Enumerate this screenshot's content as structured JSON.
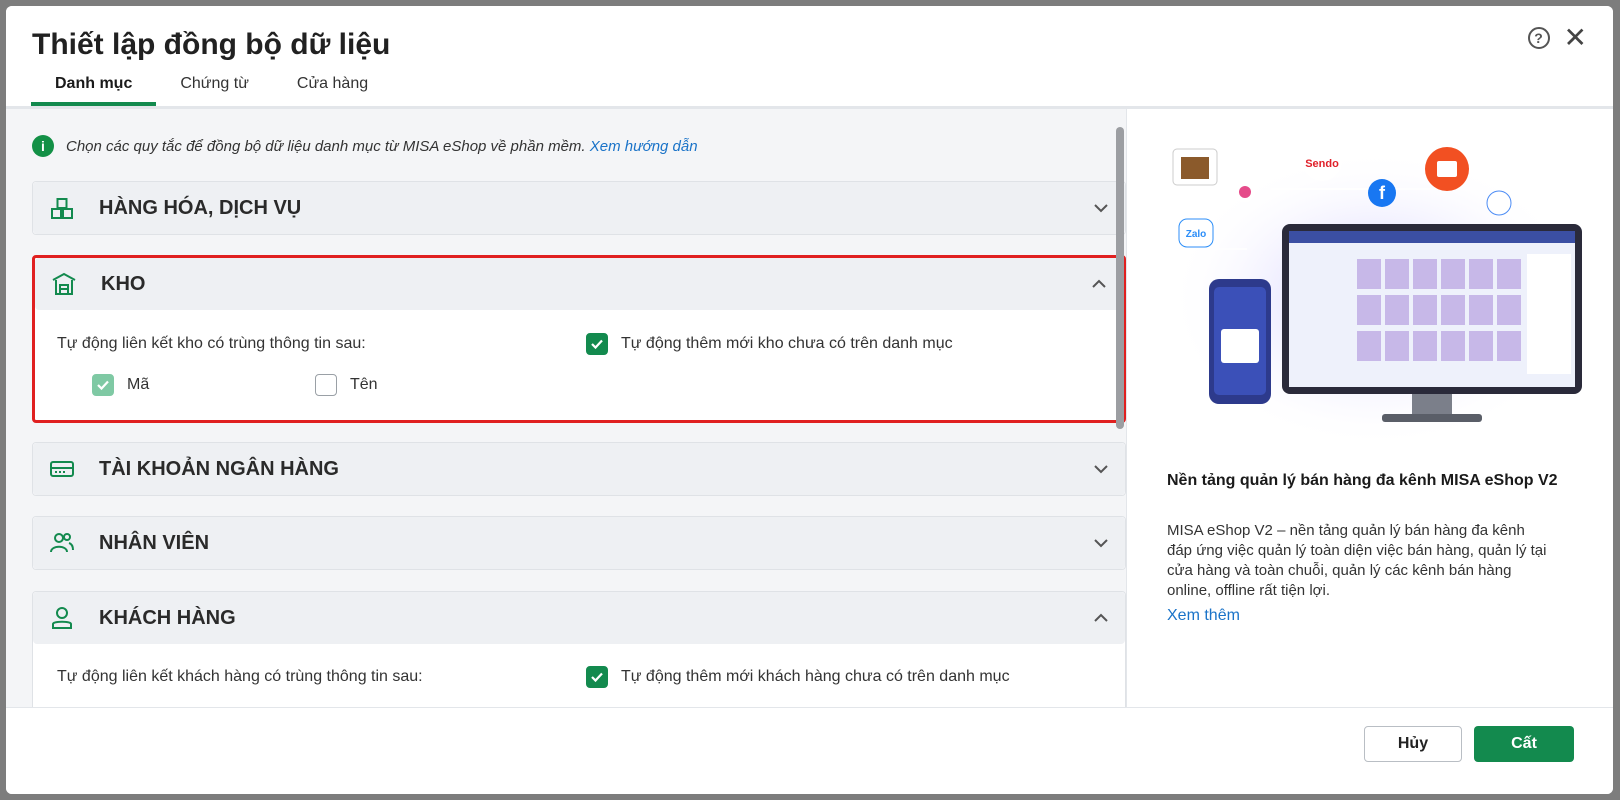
{
  "dialog": {
    "title": "Thiết lập đồng bộ dữ liệu",
    "tabs": [
      {
        "label": "Danh mục",
        "active": true
      },
      {
        "label": "Chứng từ",
        "active": false
      },
      {
        "label": "Cửa hàng",
        "active": false
      }
    ]
  },
  "info": {
    "text": "Chọn các quy tắc để đồng bộ dữ liệu danh mục từ MISA eShop về phần mềm.",
    "link": "Xem hướng dẫn"
  },
  "sections": {
    "goods": {
      "title": "HÀNG HÓA, DỊCH VỤ",
      "expanded": false
    },
    "warehouse": {
      "title": "KHO",
      "expanded": true,
      "match_label": "Tự động liên kết kho có trùng thông tin sau:",
      "auto_add_label": "Tự động thêm mới kho chưa có trên danh mục",
      "auto_add_checked": true,
      "code_label": "Mã",
      "code_checked": true,
      "name_label": "Tên",
      "name_checked": false
    },
    "bank": {
      "title": "TÀI KHOẢN NGÂN HÀNG",
      "expanded": false
    },
    "employee": {
      "title": "NHÂN VIÊN",
      "expanded": false
    },
    "customer": {
      "title": "KHÁCH HÀNG",
      "expanded": true,
      "match_label": "Tự động liên kết khách hàng có trùng thông tin sau:",
      "auto_add_label": "Tự động thêm mới khách hàng chưa có trên danh mục",
      "auto_add_checked": true
    }
  },
  "promo": {
    "title": "Nền tảng quản lý bán hàng đa kênh MISA eShop V2",
    "description": "MISA eShop V2 – nền tảng quản lý bán hàng đa kênh đáp ứng việc quản lý toàn diện việc bán hàng, quản lý tại cửa hàng và toàn chuỗi, quản lý các kênh bán hàng online, offline rất tiện lợi.",
    "link": "Xem thêm",
    "channels": {
      "sendo": "Sendo",
      "zalo": "Zalo"
    }
  },
  "footer": {
    "cancel_label": "Hủy",
    "save_label": "Cất"
  },
  "colors": {
    "accent": "#138a4e",
    "highlight_border": "#e02020",
    "link": "#1a73c8"
  }
}
